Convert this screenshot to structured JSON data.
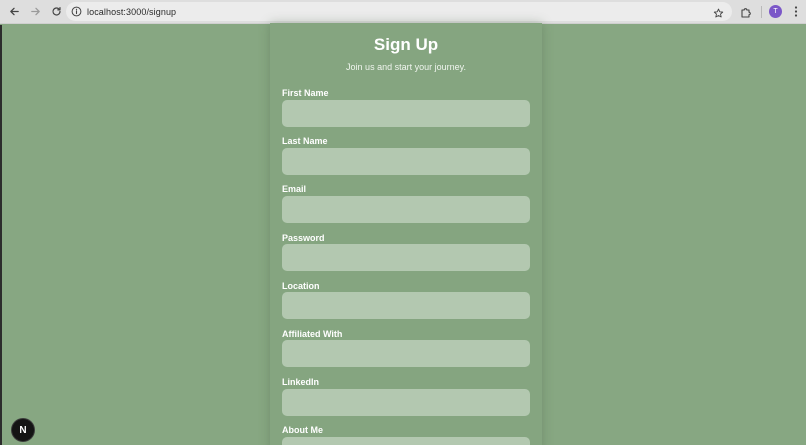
{
  "browser": {
    "url": "localhost:3000/signup",
    "profile_initial": "T"
  },
  "form": {
    "title": "Sign Up",
    "subtitle": "Join us and start your journey.",
    "fields": [
      {
        "label": "First Name",
        "value": ""
      },
      {
        "label": "Last Name",
        "value": ""
      },
      {
        "label": "Email",
        "value": ""
      },
      {
        "label": "Password",
        "value": ""
      },
      {
        "label": "Location",
        "value": ""
      },
      {
        "label": "Affiliated With",
        "value": ""
      },
      {
        "label": "LinkedIn",
        "value": ""
      },
      {
        "label": "About Me",
        "value": ""
      }
    ]
  },
  "dev_badge": {
    "letter": "N"
  }
}
